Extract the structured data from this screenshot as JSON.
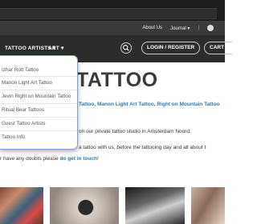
{
  "top_bar": {
    "links": [
      "About Us",
      "Journal",
      "|"
    ]
  },
  "nav": {
    "tattoo_artists": "TATTOO ARTISTS",
    "art": "ART",
    "login_register": "LOGIN / REGISTER",
    "cart": "CART /"
  },
  "dropdown_items": [
    "Izhar Rott Tattoo",
    "Manon Light Art Tattoo",
    "Jevin Right on Mountain Tattoo",
    "Ritual Bear Tattoos",
    "Guest Tattoo Artists",
    "Tattoo Info"
  ],
  "main": {
    "heading": "TATTOO",
    "artists_line": "Tattoo, Manon Light Art Tattoo, Right on Mountain Tattoo",
    "studio_line": "on our private tattoo studio in Amsterdam Noord.",
    "booking_line": "a tattoo with us, before the tattooing day and all about t",
    "doubts_prefix": "r have any doubts please ",
    "doubts_link": "do get in touch",
    "doubts_suffix": "!"
  }
}
